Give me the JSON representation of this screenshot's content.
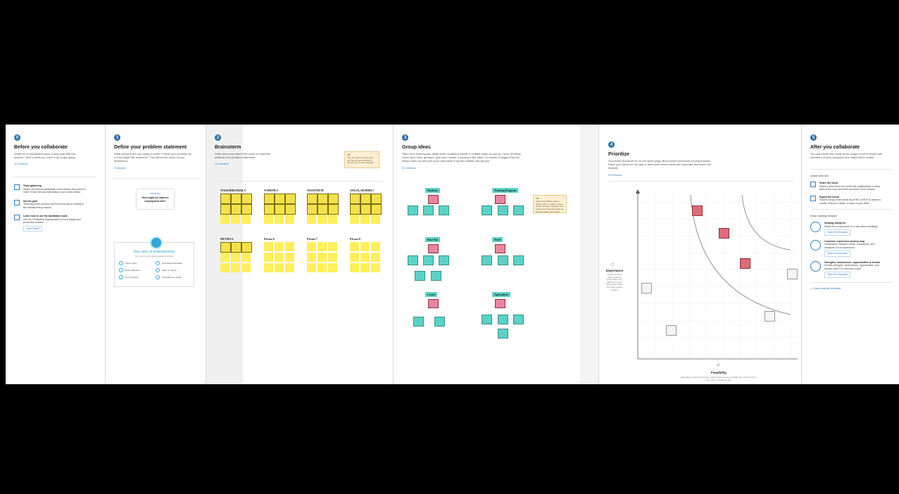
{
  "panels": {
    "p1": {
      "step": "0",
      "title": "Before you collaborate",
      "desc": "A little bit of preparation goes a long way with this session. Here's what you need to do to get going.",
      "time": "10 minutes",
      "items": [
        {
          "title": "Team gathering",
          "text": "Define who should participate in the session and send an invite. Share relevant information or pre-work ahead."
        },
        {
          "title": "Set the goal",
          "text": "Think about the problem you'll be focusing on solving in the brainstorming session."
        },
        {
          "title": "Learn how to use the facilitation tools",
          "text": "Use the Facilitation Superpowers to run a happy and productive session."
        }
      ],
      "open_article": "Open article"
    },
    "p2": {
      "step": "1",
      "title": "Define your problem statement",
      "desc": "What problem are you trying to solve? Frame your problem as a How Might We statement. This will be the focus of your brainstorm.",
      "time": "5 minutes",
      "card_tag": "PROBLEM",
      "card_text": "How might we improve employment rate?",
      "rules_title": "Key rules of brainstorming",
      "rules_sub": "To run an smooth and productive session",
      "rules": [
        "Stay in topic.",
        "Encourage wild ideas.",
        "Defer judgment.",
        "Listen to others.",
        "Go for volume.",
        "If possible, be visual."
      ]
    },
    "p3": {
      "step": "2",
      "title": "Brainstorm",
      "desc": "Write down any ideas that come to mind that address your problem statement.",
      "time": "10 minutes",
      "tip_label": "TIP",
      "tip_text": "You can select a sticky note and hit the pencil (switch to sketch) icon to start drawing!",
      "people": [
        "YOGESHKUMAR S",
        "YOHITH S",
        "ANANTHI M",
        "ANGALAKSHMI I",
        "MUTHA S",
        "Person 6",
        "Person 7",
        "Person 8"
      ]
    },
    "p4": {
      "step": "3",
      "title": "Group ideas",
      "desc": "Take turns sharing your ideas while clustering similar or related notes as you go. Once all sticky notes have been grouped, give each cluster a sentence-like label. If a cluster is bigger than six sticky notes, try and see if you and break it up into smaller sub-groups.",
      "time": "20 minutes",
      "clusters": [
        "Students",
        "Training Program",
        "Start Up",
        "Need",
        "Create",
        "Agriculture"
      ],
      "tip_label": "TIP",
      "tip_text": "Add customizable tags to sticky notes to make it easier to find, browse, organize, and categorize important ideas as themes within your mural."
    },
    "p5": {
      "step": "4",
      "title": "Prioritize",
      "desc": "Your team should all be on the same page about what's important moving forward. Place your ideas on this grid to determine which ideas are important and which are feasible.",
      "time": "20 minutes",
      "y_label": "Importance",
      "y_desc": "If each of these tasks could get done without any difficulty or cost, which would have the most positive impact?",
      "x_label": "Feasibility",
      "x_desc": "Regardless of their importance, which tasks are more feasible than others? (Cost, time, effort, complexity, etc.)"
    },
    "p6": {
      "step": "5",
      "title": "After you collaborate",
      "desc": "You can export the mural as an image or pdf to share with members of your company who might find it helpful.",
      "quick_title": "Quick add-ons",
      "quick": [
        {
          "title": "Share the mural",
          "text": "Share a view link to the mural with stakeholders to keep them in the loop about the outcomes of the session."
        },
        {
          "title": "Export the mural",
          "text": "Export a copy of the mural as a PNG or PDF to attach to emails, include in slides, or save in your drive."
        }
      ],
      "forward_title": "Keep moving forward",
      "forward": [
        {
          "title": "Strategy blueprint",
          "text": "Define the components of a new idea or strategy.",
          "link": "Open the template"
        },
        {
          "title": "Customer experience journey map",
          "text": "Understand customer needs, motivations, and obstacles for an experience.",
          "link": "Open the template"
        },
        {
          "title": "Strengths, weaknesses, opportunities & threats",
          "text": "Identify strengths, weaknesses, opportunities, and threats (SWOT) to develop a plan.",
          "link": "Open the template"
        }
      ],
      "feedback": "Share template feedback"
    }
  }
}
